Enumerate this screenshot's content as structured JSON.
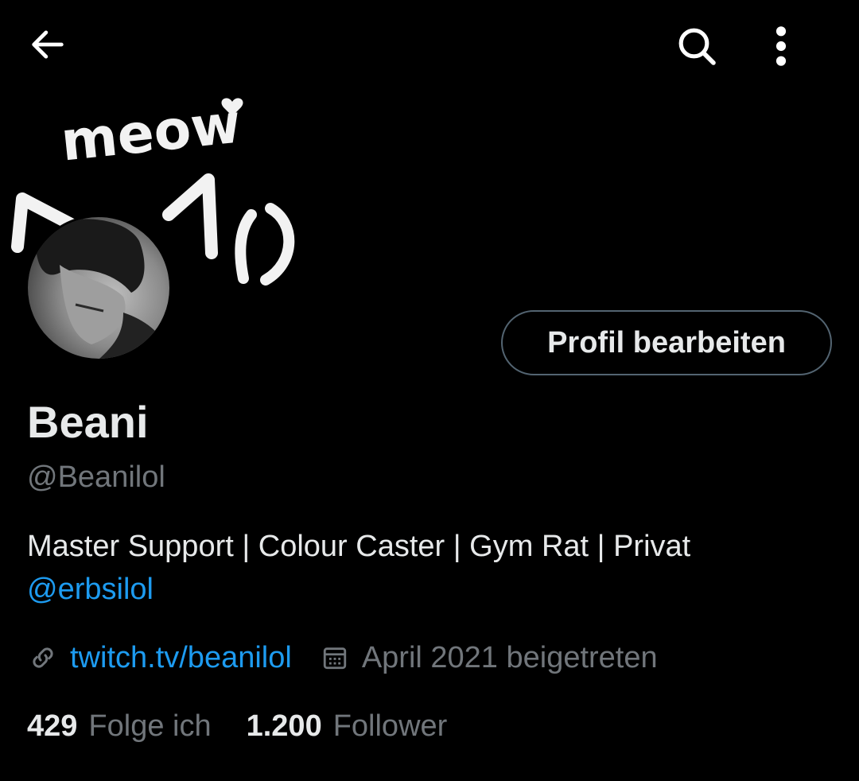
{
  "banner": {
    "doodle_text": "meow"
  },
  "header": {
    "back_icon": "arrow-left-icon",
    "search_icon": "search-icon",
    "more_icon": "more-vertical-icon"
  },
  "profile": {
    "edit_button_label": "Profil bearbeiten",
    "display_name": "Beani",
    "handle": "@Beanilol",
    "bio_text": "Master Support | Colour Caster | Gym Rat | Privat",
    "bio_mention": "@erbsilol",
    "website": "twitch.tv/beanilol",
    "joined": "April 2021 beigetreten"
  },
  "stats": {
    "following_count": "429",
    "following_label": "Folge ich",
    "followers_count": "1.200",
    "followers_label": "Follower"
  },
  "colors": {
    "background": "#000000",
    "primary_text": "#e7e9ea",
    "secondary_text": "#71767b",
    "link": "#1d9bf0",
    "button_border": "#536471"
  }
}
